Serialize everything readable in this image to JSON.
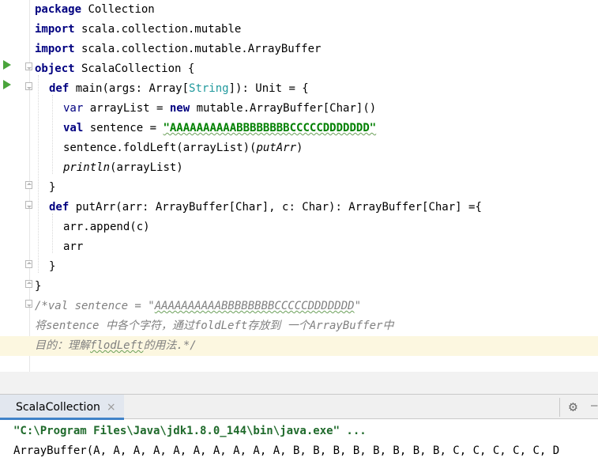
{
  "editor": {
    "lines": {
      "l1": {
        "kw": "package",
        "rest": " Collection"
      },
      "l2": {
        "kw": "import",
        "rest": " scala.collection.mutable"
      },
      "l3": {
        "kw": "import",
        "rest": " scala.collection.mutable.ArrayBuffer"
      },
      "l4": {
        "kw": "object",
        "rest": " ScalaCollection {"
      },
      "l5": {
        "kw": "def",
        "a": " main(args: Array[",
        "type": "String",
        "b": "]): Unit = {"
      },
      "l6": {
        "kw": "var",
        "a": " arrayList = ",
        "kw2": "new",
        "b": " mutable.ArrayBuffer[Char]()"
      },
      "l7": {
        "kw": "val",
        "a": " sentence = ",
        "str": "\"AAAAAAAAAABBBBBBBBCCCCCDDDDDDD\""
      },
      "l8": {
        "a": "sentence.foldLeft(arrayList)(",
        "it": "putArr",
        "b": ")"
      },
      "l9": {
        "it": "println",
        "b": "(arrayList)"
      },
      "l10": {
        "a": "}"
      },
      "l11": {
        "kw": "def",
        "a": " putArr(arr: ArrayBuffer[Char], c: Char): ArrayBuffer[Char] ={"
      },
      "l12": {
        "a": "arr.append(c)"
      },
      "l13": {
        "a": "arr"
      },
      "l14": {
        "a": "}"
      },
      "l15": {
        "a": "}"
      },
      "l16": {
        "a": "/*val sentence = \"",
        "sq": "AAAAAAAAAABBBBBBBBCCCCCDDDDDDD",
        "b": "\""
      },
      "l17": {
        "a": "将sentence 中各个字符，通过foldLeft存放到 一个ArrayBuffer中"
      },
      "l18": {
        "a": "目的：理解",
        "sq": "flodLeft",
        "b": "的用法.*/"
      }
    }
  },
  "toolwindow": {
    "tab_label": "ScalaCollection",
    "tab_close": "×",
    "settings_icon": "gear-icon"
  },
  "console": {
    "command": "\"C:\\Program Files\\Java\\jdk1.8.0_144\\bin\\java.exe\" ...",
    "output": "ArrayBuffer(A, A, A, A, A, A, A, A, A, A, B, B, B, B, B, B, B, B, C, C, C, C, C, D"
  },
  "colors": {
    "keyword": "#000080",
    "string": "#008000",
    "comment": "#808080",
    "type": "#20999d",
    "run_icon": "#49a43b",
    "current_line": "#fcf7e0"
  }
}
